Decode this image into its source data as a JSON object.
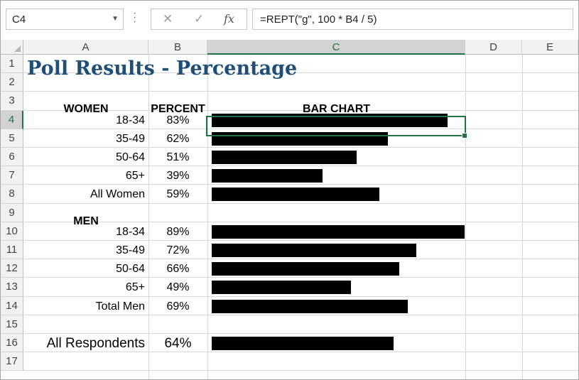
{
  "formula_bar": {
    "name_box": "C4",
    "cancel_icon": "✕",
    "enter_icon": "✓",
    "fx_label": "fx",
    "formula": "=REPT(\"g\", 100 * B4 / 5)"
  },
  "columns": [
    "A",
    "B",
    "C",
    "D",
    "E"
  ],
  "selected_column": "C",
  "rows": [
    "1",
    "2",
    "3",
    "4",
    "5",
    "6",
    "7",
    "8",
    "9",
    "10",
    "11",
    "12",
    "13",
    "14",
    "15",
    "16",
    "17"
  ],
  "selected_row": "4",
  "sheet": {
    "title": "Poll Results - Percentage",
    "header_women": "WOMEN",
    "header_percent": "PERCENT",
    "header_bar_chart": "BAR CHART",
    "header_men": "MEN",
    "women": [
      {
        "label": "18-34",
        "percent": "83%",
        "value": 0.83
      },
      {
        "label": "35-49",
        "percent": "62%",
        "value": 0.62
      },
      {
        "label": "50-64",
        "percent": "51%",
        "value": 0.51
      },
      {
        "label": "65+",
        "percent": "39%",
        "value": 0.39
      },
      {
        "label": "All Women",
        "percent": "59%",
        "value": 0.59
      }
    ],
    "men": [
      {
        "label": "18-34",
        "percent": "89%",
        "value": 0.89
      },
      {
        "label": "35-49",
        "percent": "72%",
        "value": 0.72
      },
      {
        "label": "50-64",
        "percent": "66%",
        "value": 0.66
      },
      {
        "label": "65+",
        "percent": "49%",
        "value": 0.49
      },
      {
        "label": "Total Men",
        "percent": "69%",
        "value": 0.69
      }
    ],
    "all": {
      "label": "All Respondents",
      "percent": "64%",
      "value": 0.64
    }
  }
}
